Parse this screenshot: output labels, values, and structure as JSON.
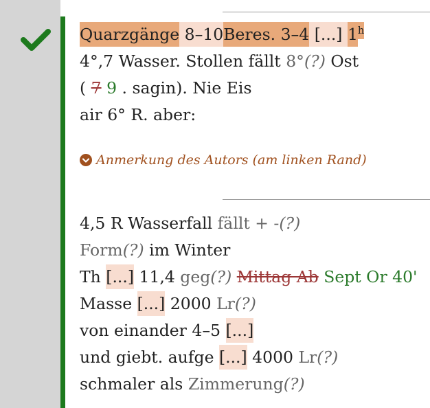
{
  "colors": {
    "accent_green": "#1d7a1d",
    "highlight_strong": "#e8a97a",
    "highlight_light": "#f8ddd0",
    "note_brown": "#a0501e",
    "deletion_red": "#9c3636",
    "addition_green": "#2a7a2a",
    "unclear_gray": "#666666"
  },
  "icons": {
    "status": "check-icon",
    "note": "chevron-down-circle-icon"
  },
  "block1": {
    "line1": {
      "t1": "Quarzgänge",
      "t2": " 8–10",
      "t3": "Beres. 3–4",
      "t4": " ",
      "t5": "[...]",
      "t6": " ",
      "t7": "1",
      "t8": "h"
    },
    "line2": {
      "t1": "4°,7 Wasser. Stollen fällt ",
      "t2": "8°",
      "t3": "(?)",
      "t4": " Ost"
    },
    "line3": {
      "t1": "( ",
      "t2": "7",
      "t3": " ",
      "t4": "9",
      "t5": " . sagin). Nie Eis"
    },
    "line4": {
      "t1": "air 6° R. aber:"
    }
  },
  "note": {
    "label": "Anmerkung des Autors (am linken Rand)"
  },
  "block2": {
    "line1": {
      "t1": "4,5 R Wasserfall ",
      "t2": "fällt + -",
      "t3": "(?)"
    },
    "line2": {
      "t1": "Form",
      "t2": "(?)",
      "t3": " im Winter"
    },
    "line3": {
      "t1": "Th ",
      "t2": "[...]",
      "t3": " 11,4 ",
      "t4": "geg",
      "t5": "(?)",
      "t6": " ",
      "t7": "Mittag Ab",
      "t8": " ",
      "t9": "Sept Or 40'"
    },
    "line4": {
      "t1": "Masse ",
      "t2": "[...]",
      "t3": " 2000 ",
      "t4": "Lr",
      "t5": "(?)"
    },
    "line5": {
      "t1": "von einander 4–5 ",
      "t2": "[...]"
    },
    "line6": {
      "t1": "und giebt. aufge ",
      "t2": "[...]",
      "t3": " 4000 ",
      "t4": "Lr",
      "t5": "(?)"
    },
    "line7": {
      "t1": "schmaler als ",
      "t2": "Zimmerung",
      "t3": "(?)"
    }
  }
}
